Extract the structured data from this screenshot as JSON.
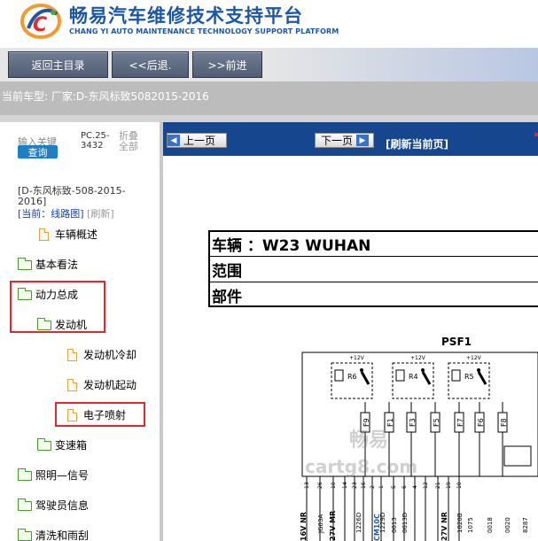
{
  "header": {
    "title": "畅易汽车维修技术支持平台",
    "subtitle": "CHANG YI AUTO MAINTENANCE TECHNOLOGY SUPPORT PLATFORM"
  },
  "nav": {
    "home_label": "返回主目录",
    "back_label": "<<后退.",
    "forward_label": ">>前进"
  },
  "vehicle": {
    "text": "当前车型:  厂家:D-东风标致5082015-2016"
  },
  "sidebar": {
    "keyword_placeholder": "输入关键",
    "query_label": "查询",
    "pc_code": "PC.25-3432",
    "collapse_label": "折叠全部",
    "path": "[D-东风标致-508-2015-2016]",
    "current_prefix": "[当前：线路图]",
    "refresh_label": "[刷新]",
    "items": [
      {
        "label": "车辆概述",
        "type": "doc"
      },
      {
        "label": "基本看法",
        "type": "folder"
      },
      {
        "label": "动力总成",
        "type": "folder-open"
      },
      {
        "label": "发动机",
        "type": "folder-open"
      },
      {
        "label": "发动机冷却",
        "type": "doc"
      },
      {
        "label": "发动机起动",
        "type": "doc"
      },
      {
        "label": "电子喷射",
        "type": "doc"
      },
      {
        "label": "变速箱",
        "type": "folder"
      },
      {
        "label": "照明—信号",
        "type": "folder"
      },
      {
        "label": "驾驶员信息",
        "type": "folder"
      },
      {
        "label": "清洗和雨刮",
        "type": "folder"
      }
    ]
  },
  "toolbar": {
    "prev_label": "上一页",
    "next_label": "下一页",
    "refresh_label": "[刷新当前页]"
  },
  "diagram": {
    "vehicle_row": "车辆 ：W23 WUHAN",
    "range_row": "范围",
    "part_row": "部件",
    "unit_title": "PSF1",
    "relays": [
      "R6",
      "R4",
      "R5"
    ],
    "relay_voltage": "+12V",
    "fuses": [
      "F9",
      "F1",
      "F3",
      "F5",
      "F7",
      "F6",
      "F8"
    ],
    "wire_labels": [
      "16V NR",
      "27V MR",
      "CM10C",
      "27V NR"
    ],
    "wire_codes": [
      "JG03A",
      "1226D",
      "1229D",
      "0013",
      "0013D",
      "1020B",
      "1075",
      "0018",
      "0020",
      "8287"
    ],
    "pin_numbers": [
      "13",
      "26",
      "10",
      "14",
      "23",
      "16",
      "2",
      "1",
      "5",
      "6",
      "4",
      "12",
      "21",
      "19",
      "10"
    ],
    "watermark_cn": "畅易",
    "watermark_en": "cartg8.com"
  }
}
